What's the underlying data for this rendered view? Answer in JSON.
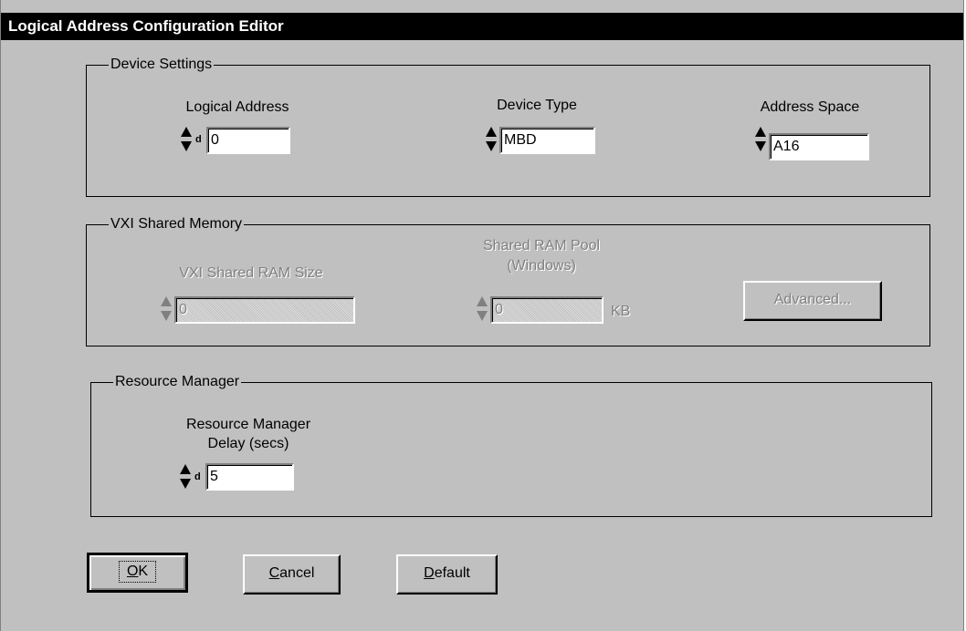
{
  "window": {
    "title": "Logical Address Configuration Editor"
  },
  "device_settings": {
    "title": "Device Settings",
    "logical_address": {
      "label": "Logical Address",
      "radix": "d",
      "value": "0"
    },
    "device_type": {
      "label": "Device Type",
      "value": "MBD"
    },
    "address_space": {
      "label": "Address Space",
      "value": "A16"
    }
  },
  "vxi_shared_memory": {
    "title": "VXI Shared Memory",
    "ram_size": {
      "label": "VXI Shared RAM Size",
      "value": "0"
    },
    "ram_pool": {
      "label_line1": "Shared RAM Pool",
      "label_line2": "(Windows)",
      "value": "0",
      "unit": "KB"
    },
    "advanced_button": "Advanced..."
  },
  "resource_manager": {
    "title": "Resource Manager",
    "delay": {
      "label_line1": "Resource Manager",
      "label_line2": "Delay (secs)",
      "radix": "d",
      "value": "5"
    }
  },
  "buttons": {
    "ok_mnemonic": "O",
    "ok_rest": "K",
    "cancel_mnemonic": "C",
    "cancel_rest": "ancel",
    "default_mnemonic": "D",
    "default_rest": "efault"
  }
}
